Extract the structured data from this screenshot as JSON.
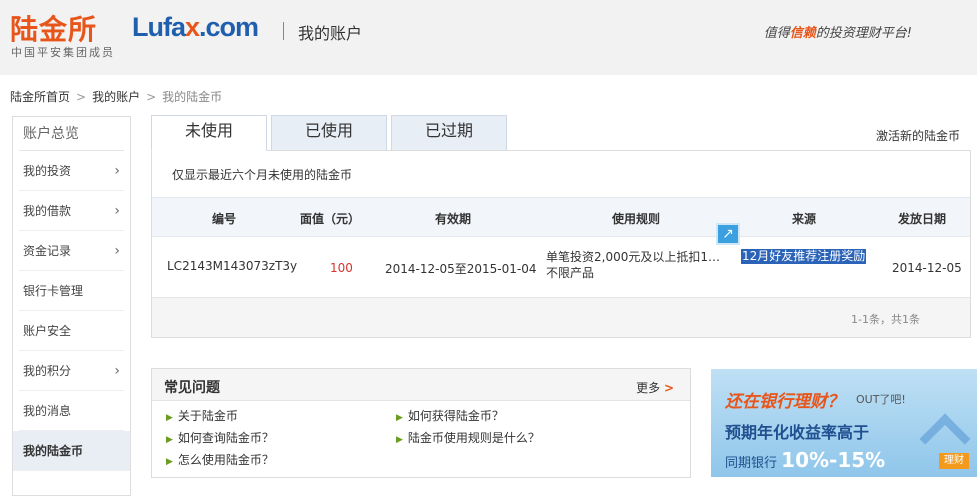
{
  "header": {
    "logo_cn": "陆金所",
    "logo_en_a": "Lufa",
    "logo_en_x": "x",
    "logo_en_b": ".com",
    "logo_sub": "中国平安集团成员",
    "title": "我的账户",
    "slogan_a": "值得",
    "slogan_hl": "信赖",
    "slogan_b": "的投资理财平台!"
  },
  "breadcrumb": {
    "home": "陆金所首页",
    "account": "我的账户",
    "current": "我的陆金币",
    "sep": ">"
  },
  "sidebar": {
    "head": "账户总览",
    "items": [
      {
        "label": "我的投资",
        "chevron": true
      },
      {
        "label": "我的借款",
        "chevron": true
      },
      {
        "label": "资金记录",
        "chevron": true
      },
      {
        "label": "银行卡管理",
        "chevron": false
      },
      {
        "label": "账户安全",
        "chevron": false
      },
      {
        "label": "我的积分",
        "chevron": true
      },
      {
        "label": "我的消息",
        "chevron": false
      },
      {
        "label": "我的陆金币",
        "chevron": false
      }
    ]
  },
  "tabs": [
    "未使用",
    "已使用",
    "已过期"
  ],
  "activate_link": "激活新的陆金币",
  "notice": "仅显示最近六个月未使用的陆金币",
  "table": {
    "headers": [
      "编号",
      "面值（元）",
      "有效期",
      "使用规则",
      "来源",
      "发放日期"
    ],
    "row": {
      "id": "LC2143M143073zT3y",
      "value": "100",
      "validity": "2014-12-05至2015-01-04",
      "rule_line1": "单笔投资2,000元及以上抵扣1…",
      "rule_line2": "不限产品",
      "source": "12月好友推荐注册奖励",
      "date": "2014-12-05"
    }
  },
  "pager": "1-1条，共1条",
  "faq": {
    "title": "常见问题",
    "more": "更多",
    "questions": [
      "关于陆金币",
      "如何获得陆金币？",
      "如何查询陆金币？",
      "陆金币使用规则是什么？",
      "怎么使用陆金币？"
    ]
  },
  "banner": {
    "line1": "还在银行理财？",
    "out": "OUT了吧!",
    "line2": "预期年化收益率高于",
    "line3_a": "同期银行",
    "line3_big": "10%-15%",
    "tag": "理财"
  },
  "icons": {
    "chevron": "chevron-right-icon",
    "share": "share-icon",
    "bullet": "bullet-icon"
  },
  "colors": {
    "brand_orange": "#e8551a",
    "brand_blue": "#1f5fae",
    "value_red": "#d9332a",
    "selection_blue": "#2a63b8"
  }
}
